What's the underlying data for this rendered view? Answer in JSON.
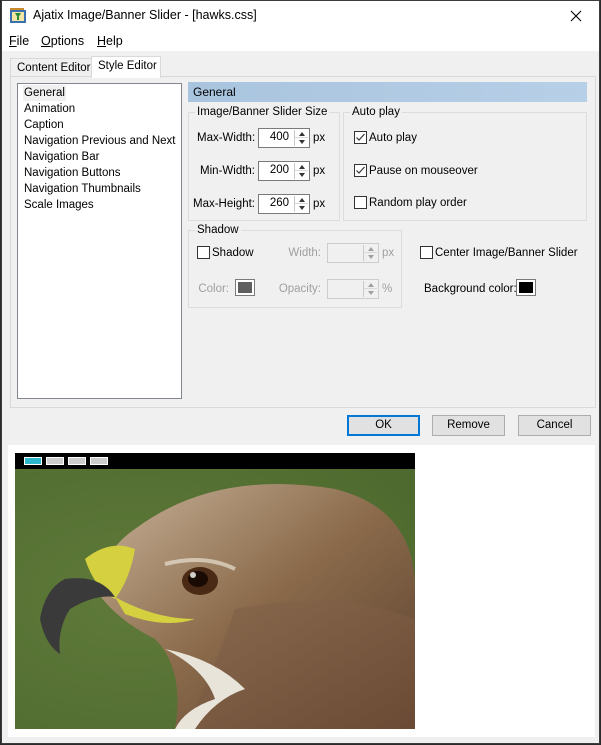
{
  "window": {
    "title": "Ajatix Image/Banner Slider - [hawks.css]",
    "app_icon": "ajatix-app-icon",
    "close_icon": "close-icon"
  },
  "menu": {
    "items": [
      {
        "label": "File",
        "mnemonic": "F",
        "rest": "ile"
      },
      {
        "label": "Options",
        "mnemonic": "O",
        "rest": "ptions"
      },
      {
        "label": "Help",
        "mnemonic": "H",
        "rest": "elp"
      }
    ]
  },
  "tabs": [
    {
      "label": "Content Editor",
      "active": false
    },
    {
      "label": "Style Editor",
      "active": true
    }
  ],
  "style_list": {
    "selected": "General",
    "items": [
      "General",
      "Animation",
      "Caption",
      "Navigation Previous and Next",
      "Navigation Bar",
      "Navigation Buttons",
      "Navigation Thumbnails",
      "Scale Images"
    ]
  },
  "general": {
    "header": "General",
    "size_group": {
      "label": "Image/Banner Slider Size",
      "max_width": {
        "label": "Max-Width:",
        "value": "400",
        "unit": "px"
      },
      "min_width": {
        "label": "Min-Width:",
        "value": "200",
        "unit": "px"
      },
      "max_height": {
        "label": "Max-Height:",
        "value": "260",
        "unit": "px"
      }
    },
    "autoplay_group": {
      "label": "Auto play",
      "auto_play": {
        "label": "Auto play",
        "checked": true
      },
      "pause_on_mouseover": {
        "label": "Pause on mouseover",
        "checked": true
      },
      "random_play_order": {
        "label": "Random play order",
        "checked": false
      }
    },
    "shadow_group": {
      "label": "Shadow",
      "shadow": {
        "label": "Shadow",
        "checked": false
      },
      "width": {
        "label": "Width:",
        "value": "",
        "unit": "px"
      },
      "color": {
        "label": "Color:",
        "value": "#5f5f5f"
      },
      "opacity": {
        "label": "Opacity:",
        "value": "",
        "unit": "%"
      }
    },
    "center": {
      "label": "Center Image/Banner Slider",
      "checked": false
    },
    "background_color": {
      "label": "Background color:",
      "value": "#000000"
    }
  },
  "buttons": {
    "ok": "OK",
    "remove": "Remove",
    "cancel": "Cancel"
  },
  "preview": {
    "nav_buttons": [
      {
        "active": true
      },
      {
        "active": false
      },
      {
        "active": false
      },
      {
        "active": false
      }
    ],
    "image_alt": "hawk-photo",
    "active_color": "#2eb7cc",
    "inactive_color": "#cccccc"
  }
}
